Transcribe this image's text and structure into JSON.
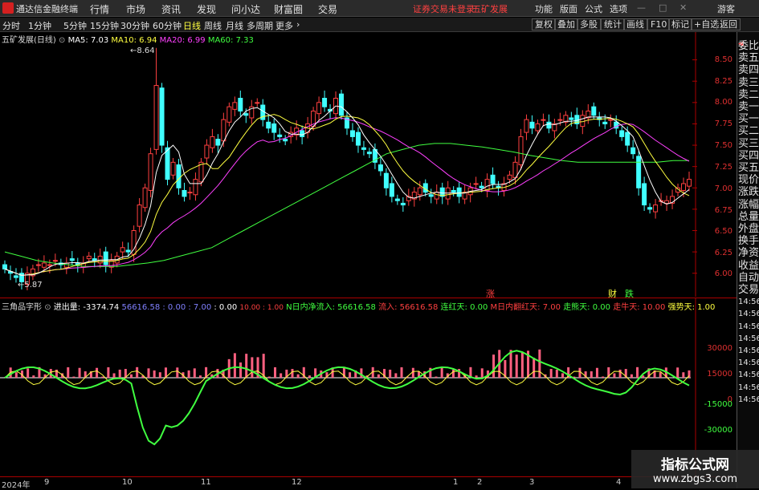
{
  "titlebar": {
    "app_name": "通达信金融终端",
    "menus": [
      "行情",
      "市场",
      "资讯",
      "发现",
      "问小达",
      "财富圈",
      "交易"
    ],
    "notice": "证券交易未登录",
    "stock_name": "五矿发展",
    "right": [
      "功能",
      "版面",
      "公式",
      "选项"
    ],
    "guest": "游客"
  },
  "toolbar": {
    "periods": [
      "分时",
      "1分钟",
      "5分钟",
      "15分钟",
      "30分钟",
      "60分钟",
      "日线",
      "周线",
      "月线",
      "多周期",
      "更多"
    ],
    "active": "日线",
    "right_buttons": [
      "复权",
      "叠加",
      "多股",
      "统计",
      "画线",
      "F10",
      "标记",
      "+自选",
      "返回"
    ]
  },
  "main_chart": {
    "legend_title": "五矿发展(日线)",
    "ma": [
      {
        "label": "MA5: 7.03",
        "color": "#ffffff"
      },
      {
        "label": "MA10: 6.94",
        "color": "#ffff40"
      },
      {
        "label": "MA20: 6.99",
        "color": "#ff40ff"
      },
      {
        "label": "MA60: 7.33",
        "color": "#40ff40"
      }
    ],
    "high_label": "8.64",
    "low_label": "5.87",
    "yticks": [
      "8.50",
      "8.25",
      "8.00",
      "7.75",
      "7.50",
      "7.25",
      "7.00",
      "6.75",
      "6.50",
      "6.25",
      "6.00"
    ],
    "markers": [
      {
        "text": "涨",
        "color": "#ff4040"
      },
      {
        "text": "财",
        "color": "#ffff40"
      },
      {
        "text": "跌",
        "color": "#40ff40"
      }
    ]
  },
  "sub_chart": {
    "legend_title": "三角品字形",
    "items": [
      {
        "label": "进出量: -3374.74",
        "color": "#ffffff"
      },
      {
        "label": "56616.58",
        "color": "#8080ff"
      },
      {
        "label": "0.00",
        "color": "#8080ff"
      },
      {
        "label": "7.00",
        "color": "#8080ff"
      },
      {
        "label": "0.00",
        "color": "#ffffff"
      },
      {
        "label": "10.00",
        "color": "#ff4040"
      },
      {
        "label": "1.00",
        "color": "#ff4040"
      },
      {
        "label": "N日内净流入: 56616.58",
        "color": "#40ff40"
      },
      {
        "label": "流入: 56616.58",
        "color": "#ff4040"
      },
      {
        "label": "连红天: 0.00",
        "color": "#40ff40"
      },
      {
        "label": "M日内翻红天: 7.00",
        "color": "#ff4040"
      },
      {
        "label": "走熊天: 0.00",
        "color": "#40ff40"
      },
      {
        "label": "走牛天: 10.00",
        "color": "#ff4040"
      },
      {
        "label": "强势天: 1.00",
        "color": "#ffff40"
      }
    ],
    "yticks": [
      "30000",
      "15000",
      "0",
      "-15000",
      "-30000"
    ]
  },
  "xaxis": {
    "labels": [
      "2024年",
      "9",
      "10",
      "11",
      "12",
      "1",
      "2",
      "3",
      "4"
    ]
  },
  "sidebar": {
    "items": [
      "委比",
      "卖五",
      "卖四",
      "卖三",
      "卖二",
      "卖一",
      "买一",
      "买二",
      "买三",
      "买四",
      "买五",
      "现价",
      "涨跌",
      "涨幅",
      "总量",
      "外盘",
      "换手",
      "净资",
      "收益"
    ],
    "items2": [
      "自动",
      "交易",
      "14:56",
      "14:56",
      "14:56",
      "14:56",
      "14:56",
      "14:56",
      "14:56",
      "14:56",
      "14:56"
    ]
  },
  "watermark": {
    "title": "指标公式网",
    "url": "www.zbgs3.com"
  },
  "chart_data": {
    "type": "candlestick",
    "ylim": [
      5.8,
      8.75
    ],
    "closes": [
      6.05,
      6.0,
      5.95,
      5.9,
      6.0,
      6.05,
      6.1,
      6.12,
      6.1,
      6.15,
      6.1,
      6.12,
      6.15,
      6.1,
      6.12,
      6.2,
      6.15,
      6.2,
      6.1,
      6.15,
      6.2,
      6.3,
      6.25,
      6.5,
      6.8,
      7.0,
      7.4,
      8.2,
      7.5,
      7.1,
      7.3,
      7.0,
      6.9,
      6.95,
      7.1,
      7.3,
      7.5,
      7.6,
      7.5,
      7.8,
      7.95,
      8.0,
      7.9,
      7.85,
      7.95,
      8.0,
      7.8,
      7.7,
      7.65,
      7.6,
      7.55,
      7.65,
      7.7,
      7.6,
      7.75,
      7.9,
      8.0,
      7.95,
      7.9,
      8.05,
      7.85,
      7.7,
      7.6,
      7.5,
      7.45,
      7.4,
      7.3,
      7.2,
      7.0,
      6.9,
      6.85,
      6.8,
      6.9,
      6.95,
      7.0,
      6.95,
      6.9,
      6.95,
      6.9,
      7.0,
      6.95,
      6.9,
      6.95,
      7.0,
      7.05,
      7.0,
      7.1,
      7.05,
      7.0,
      7.05,
      7.15,
      7.3,
      7.6,
      7.8,
      7.7,
      7.75,
      7.8,
      7.7,
      7.75,
      7.8,
      7.85,
      7.8,
      7.75,
      7.85,
      7.9,
      7.85,
      7.8,
      7.75,
      7.8,
      7.7,
      7.6,
      7.5,
      7.4,
      7.0,
      6.8,
      6.75,
      6.8,
      6.85,
      6.85,
      6.9,
      7.0,
      7.05,
      7.1
    ],
    "ma60": [
      6.25,
      6.2,
      6.15,
      6.12,
      6.1,
      6.08,
      6.08,
      6.08,
      6.1,
      6.12,
      6.15,
      6.2,
      6.25,
      6.3,
      6.4,
      6.5,
      6.6,
      6.7,
      6.8,
      6.9,
      7.0,
      7.1,
      7.2,
      7.3,
      7.4,
      7.45,
      7.5,
      7.52,
      7.52,
      7.5,
      7.48,
      7.45,
      7.42,
      7.38,
      7.35,
      7.32,
      7.3,
      7.3,
      7.3,
      7.3,
      7.3,
      7.3,
      7.32,
      7.32
    ]
  }
}
